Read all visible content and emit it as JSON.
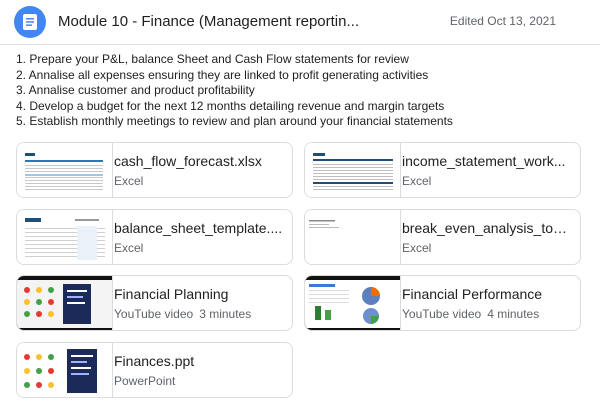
{
  "header": {
    "title": "Module 10 - Finance (Management reportin...",
    "edited": "Edited Oct 13, 2021",
    "icon": "document-icon",
    "accent": "#4285f4"
  },
  "steps": [
    "1. Prepare your P&L, balance Sheet and Cash Flow statements for review",
    "2. Annalise all expenses ensuring they are linked to profit generating activities",
    "3. Annalise customer and product profitability",
    "4. Develop a budget for the next 12 months detailing revenue and margin targets",
    "5. Establish monthly meetings to review and plan around your financial statements"
  ],
  "attachments": [
    {
      "name": "cash_flow_forecast.xlsx",
      "type": "Excel",
      "duration": ""
    },
    {
      "name": "income_statement_work...",
      "type": "Excel",
      "duration": ""
    },
    {
      "name": "balance_sheet_template....",
      "type": "Excel",
      "duration": ""
    },
    {
      "name": "break_even_analysis_too...",
      "type": "Excel",
      "duration": ""
    },
    {
      "name": "Financial Planning",
      "type": "YouTube video",
      "duration": "3 minutes"
    },
    {
      "name": "Financial Performance",
      "type": "YouTube video",
      "duration": "4 minutes"
    },
    {
      "name": "Finances.ppt",
      "type": "PowerPoint",
      "duration": ""
    }
  ]
}
